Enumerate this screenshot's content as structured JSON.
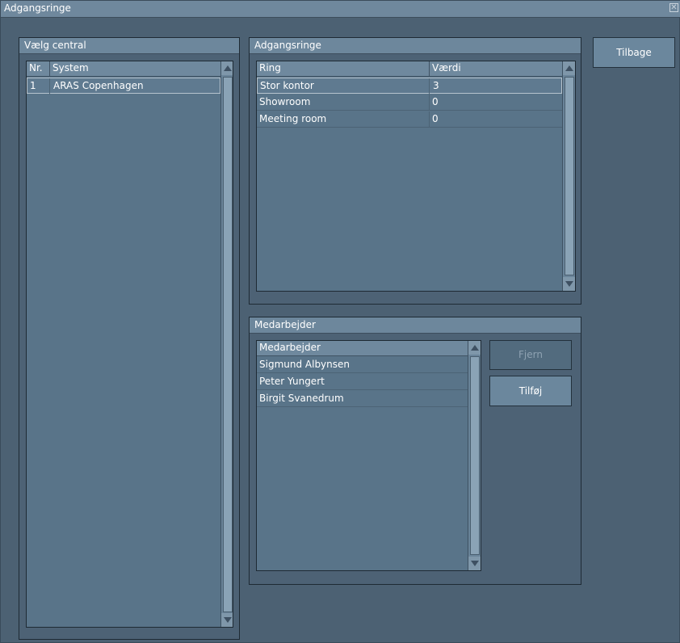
{
  "window": {
    "title": "Adgangsringe",
    "close_glyph": "✕"
  },
  "left_panel": {
    "title": "Vælg central",
    "columns": [
      "Nr.",
      "System"
    ],
    "rows": [
      {
        "nr": "1",
        "system": "ARAS Copenhagen"
      }
    ]
  },
  "rings_panel": {
    "title": "Adgangsringe",
    "columns": [
      "Ring",
      "Værdi"
    ],
    "rows": [
      {
        "ring": "Stor kontor",
        "value": "3"
      },
      {
        "ring": "Showroom",
        "value": "0"
      },
      {
        "ring": "Meeting room",
        "value": "0"
      }
    ]
  },
  "employees_panel": {
    "title": "Medarbejder",
    "column": "Medarbejder",
    "rows": [
      "Sigmund Albynsen",
      "Peter Yungert",
      "Birgit Svanedrum"
    ],
    "remove_label": "Fjern",
    "add_label": "Tilføj"
  },
  "back_button": "Tilbage",
  "icons": {
    "close": "close-icon",
    "scroll_up": "scroll-up-icon",
    "scroll_down": "scroll-down-icon"
  }
}
